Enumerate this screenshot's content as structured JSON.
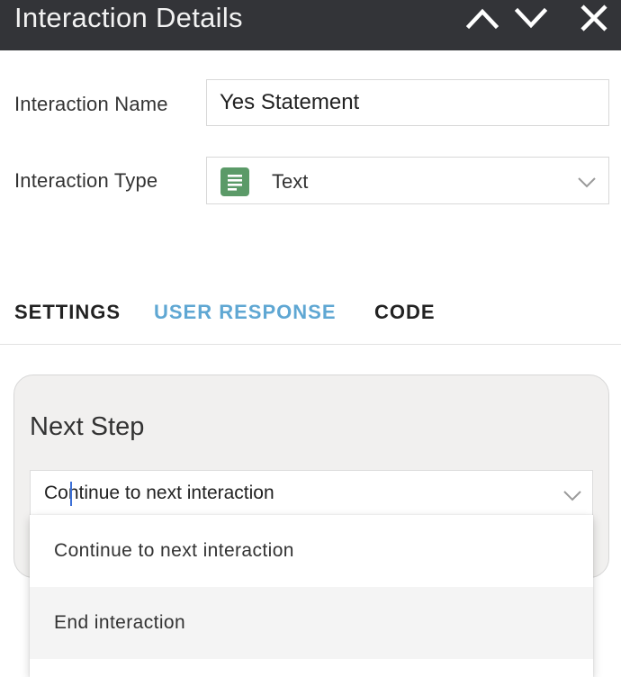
{
  "header": {
    "title": "Interaction Details",
    "up_icon": "chevron-up-icon",
    "down_icon": "chevron-down-icon",
    "close_icon": "close-icon"
  },
  "form": {
    "name_label": "Interaction Name",
    "name_value": "Yes Statement",
    "type_label": "Interaction Type",
    "type_value": "Text",
    "type_icon": "text-document-icon",
    "type_icon_color": "#5b9a68"
  },
  "tabs": [
    {
      "label": "SETTINGS",
      "active": false
    },
    {
      "label": "USER RESPONSE",
      "active": true
    },
    {
      "label": "CODE",
      "active": false
    }
  ],
  "colors": {
    "header_bg": "#333438",
    "active_tab": "#5fa7d3",
    "card_bg": "#f1f0ef"
  },
  "next_step": {
    "title": "Next Step",
    "selected": "Continue to next interaction",
    "options": [
      "Continue to next interaction",
      "End interaction"
    ]
  }
}
